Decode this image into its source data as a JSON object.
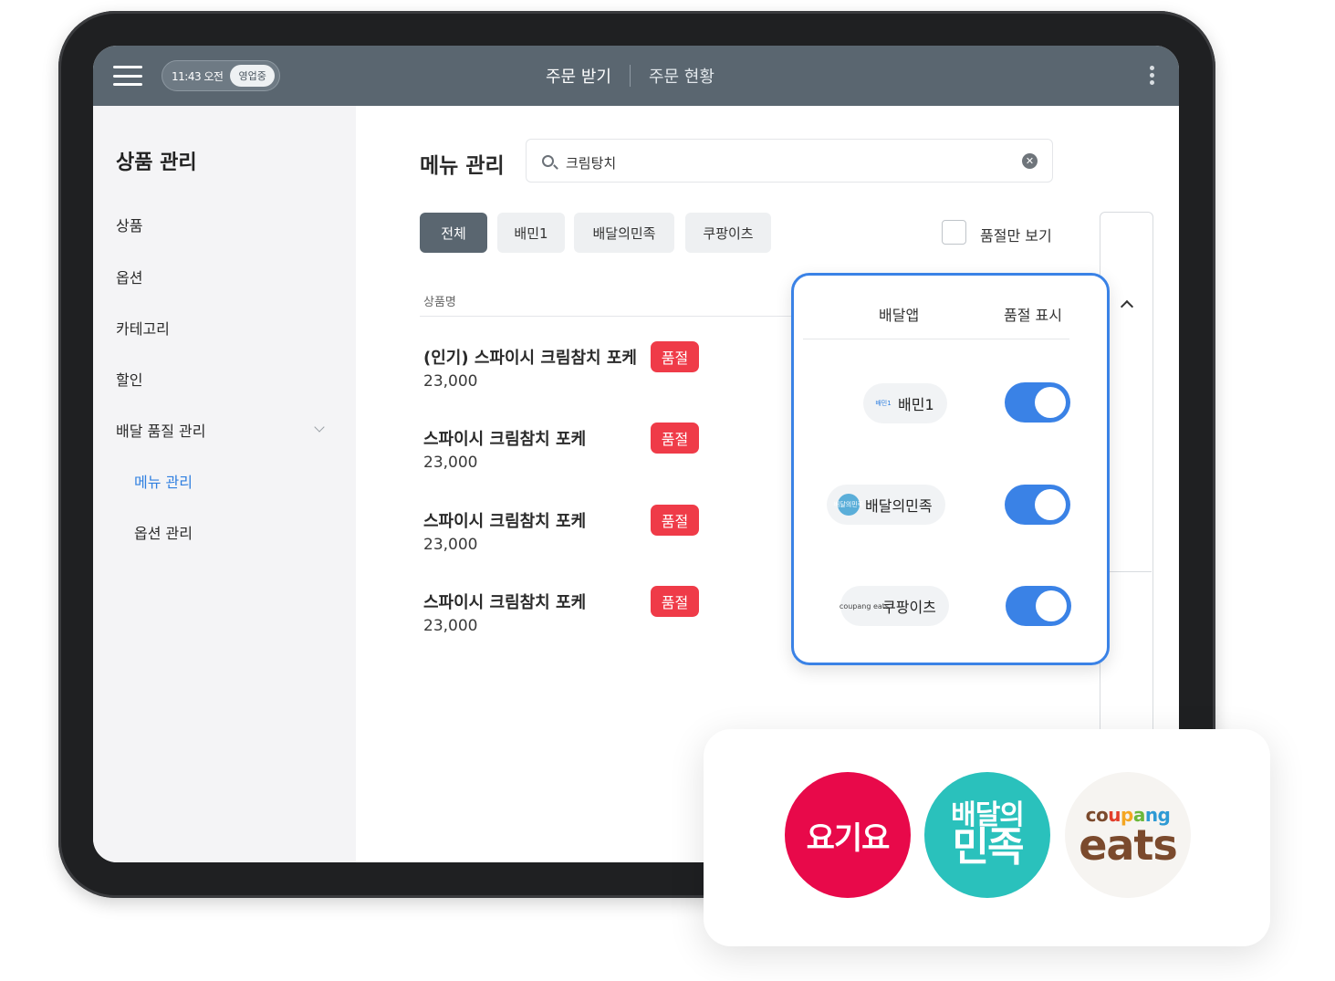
{
  "topbar": {
    "time": "11:43 오전",
    "status": "영업중",
    "tabs": [
      {
        "label": "주문 받기"
      },
      {
        "label": "주문 현황"
      }
    ]
  },
  "sidebar": {
    "title": "상품 관리",
    "items": [
      {
        "label": "상품"
      },
      {
        "label": "옵션"
      },
      {
        "label": "카테고리"
      },
      {
        "label": "할인"
      },
      {
        "label": "배달 품질 관리"
      },
      {
        "label": "메뉴 관리"
      },
      {
        "label": "옵션 관리"
      }
    ]
  },
  "main": {
    "title": "메뉴 관리",
    "search_value": "크림탕치",
    "filters": [
      {
        "label": "전체"
      },
      {
        "label": "배민1"
      },
      {
        "label": "배달의민족"
      },
      {
        "label": "쿠팡이츠"
      }
    ],
    "soldout_only_label": "품절만 보기",
    "column_header": "상품명",
    "products": [
      {
        "name": "(인기) 스파이시 크림참치 포케",
        "price": "23,000",
        "badge": "품절"
      },
      {
        "name": "스파이시 크림참치 포케",
        "price": "23,000",
        "badge": "품절"
      },
      {
        "name": "스파이시 크림참치 포케",
        "price": "23,000",
        "badge": "품절"
      },
      {
        "name": "스파이시 크림참치 포케",
        "price": "23,000",
        "badge": "품절"
      }
    ]
  },
  "popover": {
    "col_app": "배달앱",
    "col_soldout": "품절 표시",
    "apps": [
      {
        "name": "배민1",
        "logo": "배민1",
        "soldout_on": true
      },
      {
        "name": "배달의민족",
        "logo": "배달의민족",
        "soldout_on": true
      },
      {
        "name": "쿠팡이츠",
        "logo": "coupang eats",
        "soldout_on": true
      }
    ]
  },
  "logos": {
    "yogiyo": "요기요",
    "baemin_line1": "배달의",
    "baemin_line2": "민족",
    "coupang_parts": [
      "co",
      "u",
      "p",
      "a",
      "ng"
    ],
    "coupang_line2": "eats"
  },
  "colors": {
    "topbar": "#5a6670",
    "accent_blue": "#3a82e6",
    "soldout_red": "#ef3b48",
    "yogiyo": "#e8094a",
    "baemin": "#2ac1bc"
  }
}
